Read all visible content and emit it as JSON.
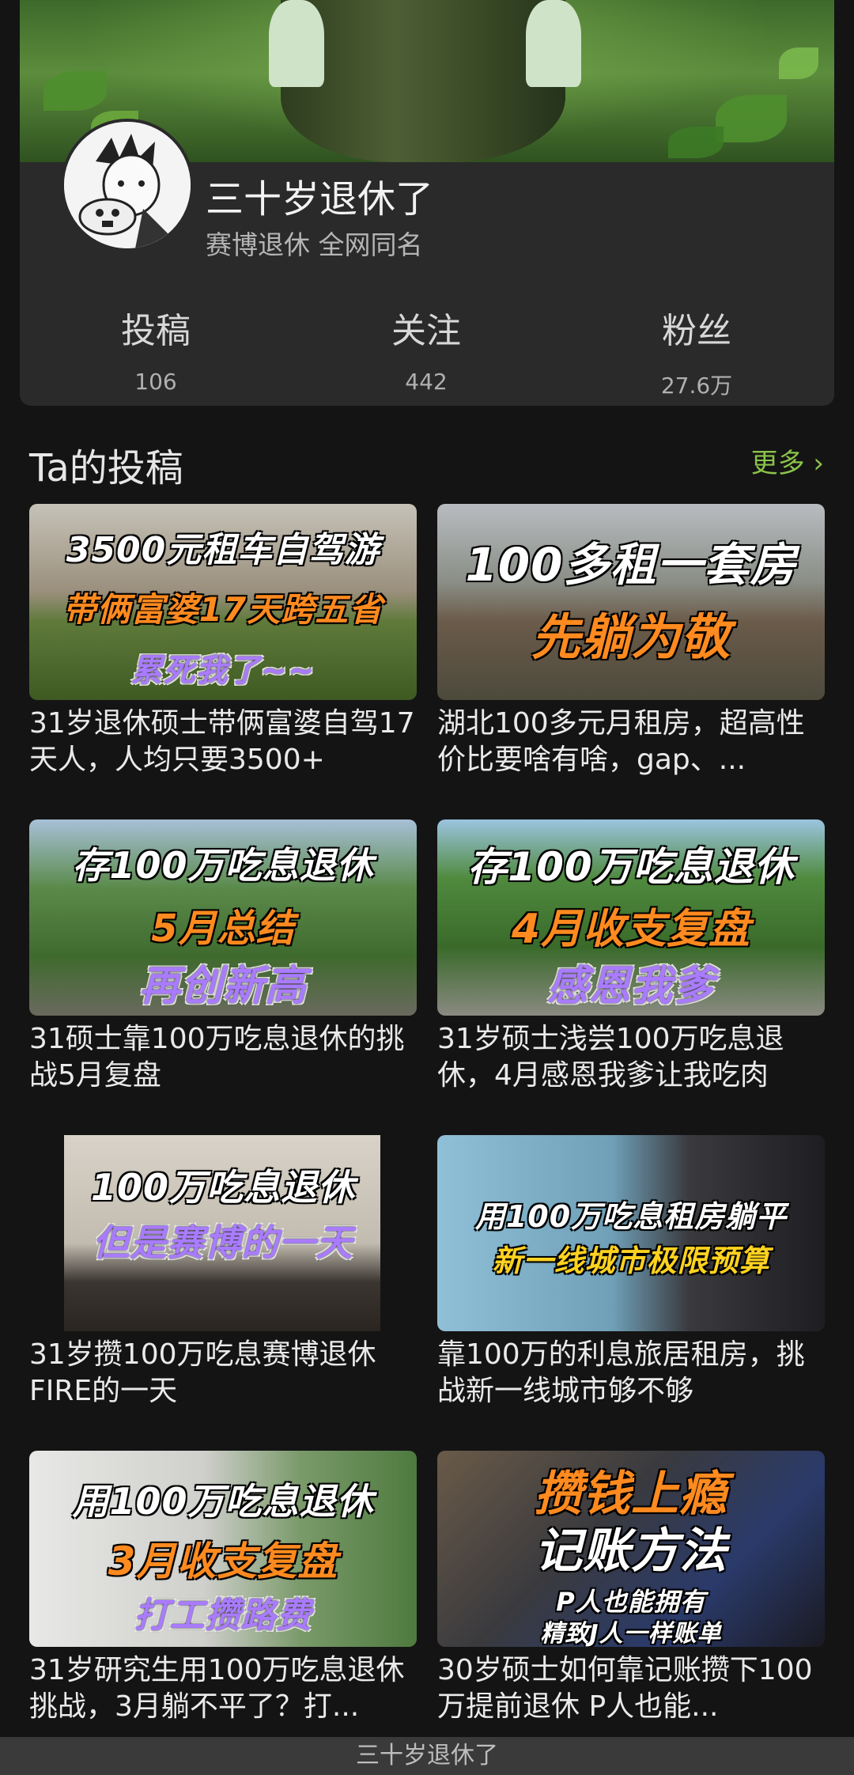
{
  "profile": {
    "name": "三十岁退休了",
    "bio": "赛博退休 全网同名",
    "stats": [
      {
        "label": "投稿",
        "value": "106"
      },
      {
        "label": "关注",
        "value": "442"
      },
      {
        "label": "粉丝",
        "value": "27.6万"
      }
    ]
  },
  "section": {
    "title": "Ta的投稿",
    "more": "更多 ›"
  },
  "videos": [
    {
      "title": "31岁退休硕士带俩富婆自驾17天人，人均只要3500+",
      "caption": [
        "3500元租车自驾游",
        "带俩富婆17天跨五省",
        "累死我了~~"
      ]
    },
    {
      "title": "湖北100多元月租房，超高性价比要啥有啥，gap、...",
      "caption": [
        "100多租一套房",
        "先躺为敬"
      ]
    },
    {
      "title": "31硕士靠100万吃息退休的挑战5月复盘",
      "caption": [
        "存100万吃息退休",
        "5月总结",
        "再创新高"
      ]
    },
    {
      "title": "31岁硕士浅尝100万吃息退休，4月感恩我爹让我吃肉",
      "caption": [
        "存100万吃息退休",
        "4月收支复盘",
        "感恩我爹"
      ]
    },
    {
      "title": "31岁攒100万吃息赛博退休FIRE的一天",
      "caption": [
        "100万吃息退休",
        "但是赛博的一天"
      ]
    },
    {
      "title": "靠100万的利息旅居租房，挑战新一线城市够不够",
      "caption": [
        "用100万吃息租房躺平",
        "新一线城市极限预算"
      ]
    },
    {
      "title": "31岁研究生用100万吃息退休挑战，3月躺不平了？打...",
      "caption": [
        "用100万吃息退休",
        "3月收支复盘",
        "打工攒路费"
      ]
    },
    {
      "title": "30岁硕士如何靠记账攒下100万提前退休 P人也能...",
      "caption": [
        "攒钱上瘾",
        "记账方法",
        "P人也能拥有",
        "精致J人一样账单"
      ]
    }
  ],
  "bottom_bar": {
    "text": "三十岁退休了"
  }
}
